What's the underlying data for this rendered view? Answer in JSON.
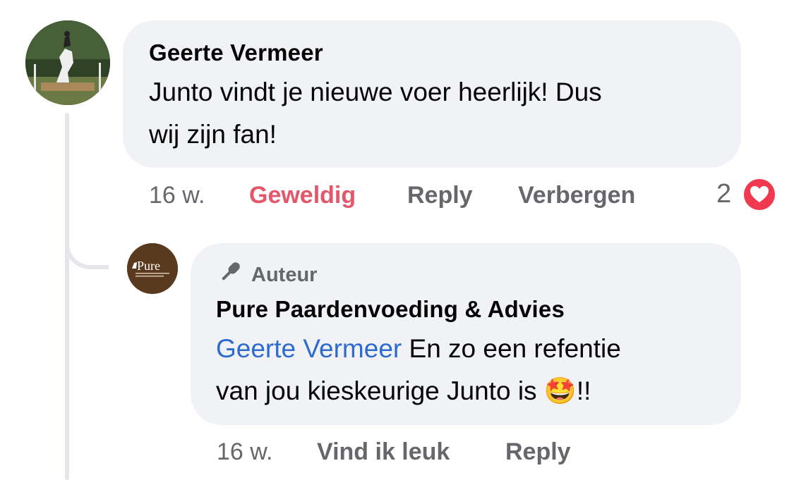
{
  "comment": {
    "author": "Geerte Vermeer",
    "text_line1": "Junto vindt je nieuwe voer heerlijk! Dus",
    "text_line2": "wij zijn fan!",
    "time": "16 w.",
    "like_label": "Geweldig",
    "reply_label": "Reply",
    "hide_label": "Verbergen",
    "reaction_count": "2",
    "reaction_icon": "heart-icon",
    "like_color": "#e4566a"
  },
  "reply": {
    "badge_label": "Auteur",
    "badge_icon": "microphone-icon",
    "author": "Pure Paardenvoeding & Advies",
    "mention": "Geerte Vermeer",
    "text_line1_rest": " En zo een refentie",
    "text_line2_start": "van jou kieskeurige Junto is ",
    "emoji": "🤩",
    "text_line2_end": "!!",
    "time": "16 w.",
    "like_label": "Vind ik leuk",
    "reply_label": "Reply",
    "logo_text": "Pure",
    "mention_color": "#2e6bd0"
  }
}
